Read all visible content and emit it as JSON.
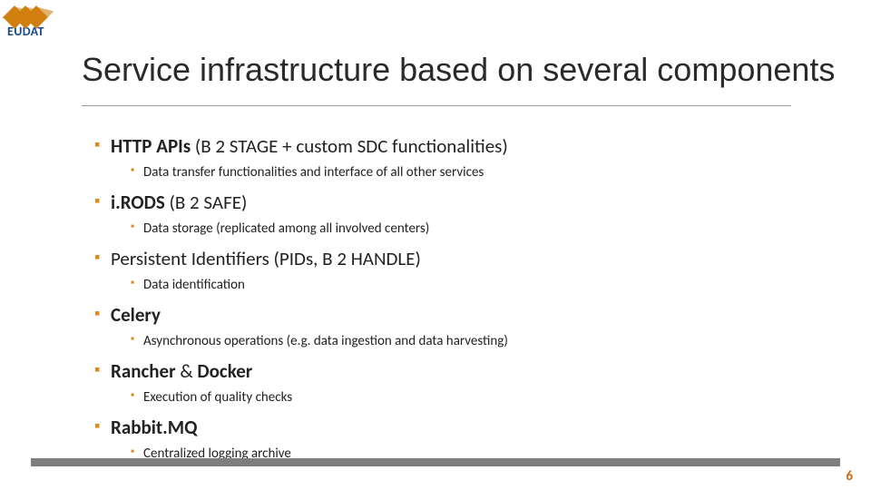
{
  "logo_text": "EUDAT",
  "title": "Service infrastructure based on several components",
  "items": [
    {
      "bold": "HTTP APIs ",
      "rest": "(B 2 STAGE + custom SDC functionalities)",
      "sub": "Data transfer functionalities and interface of all other services"
    },
    {
      "bold": "i.RODS ",
      "rest": "(B 2 SAFE)",
      "sub": "Data storage (replicated among all involved centers)"
    },
    {
      "bold": "",
      "rest": "Persistent Identifiers (PIDs, B 2 HANDLE)",
      "sub": "Data identification"
    },
    {
      "bold": "Celery",
      "rest": "",
      "sub": "Asynchronous operations (e.g. data ingestion and data harvesting)"
    },
    {
      "bold": "Rancher ",
      "rest": "& ",
      "bold2": "Docker",
      "sub": "Execution of quality checks"
    },
    {
      "bold": "Rabbit.MQ",
      "rest": "",
      "sub": "Centralized logging archive"
    }
  ],
  "page_number": "6"
}
